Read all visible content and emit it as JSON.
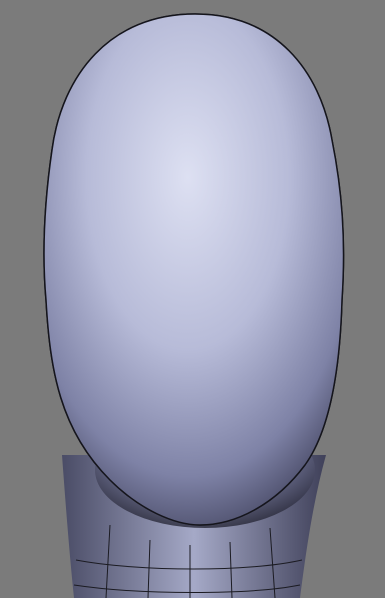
{
  "viewport": {
    "background": "#7b7b7b",
    "mesh_color": "#1b1b22",
    "surface_light": "#d9dcef",
    "surface_mid": "#9ea3c4",
    "surface_dark": "#2c2c3e",
    "subject": "head-mesh"
  }
}
